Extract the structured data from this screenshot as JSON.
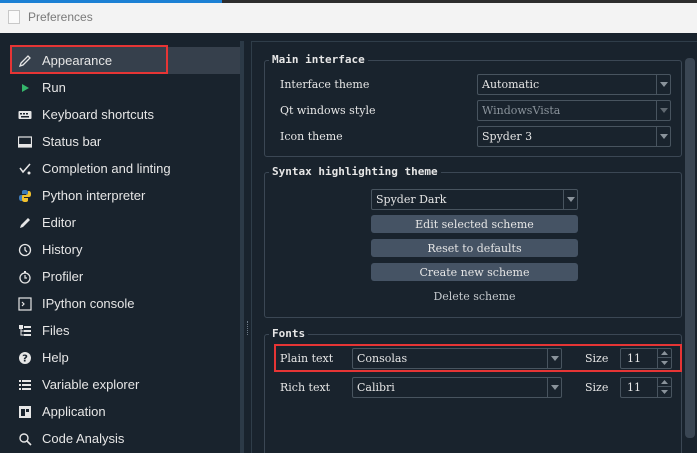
{
  "window": {
    "title": "Preferences"
  },
  "sidebar": {
    "items": [
      {
        "label": "Appearance",
        "icon": "pencil-icon",
        "selected": true
      },
      {
        "label": "Run",
        "icon": "play-icon"
      },
      {
        "label": "Keyboard shortcuts",
        "icon": "keyboard-icon"
      },
      {
        "label": "Status bar",
        "icon": "status-bar-icon"
      },
      {
        "label": "Completion and linting",
        "icon": "completion-icon"
      },
      {
        "label": "Python interpreter",
        "icon": "python-icon"
      },
      {
        "label": "Editor",
        "icon": "edit-icon"
      },
      {
        "label": "History",
        "icon": "history-icon"
      },
      {
        "label": "Profiler",
        "icon": "stopwatch-icon"
      },
      {
        "label": "IPython console",
        "icon": "console-icon"
      },
      {
        "label": "Files",
        "icon": "files-icon"
      },
      {
        "label": "Help",
        "icon": "help-icon"
      },
      {
        "label": "Variable explorer",
        "icon": "list-icon"
      },
      {
        "label": "Application",
        "icon": "application-icon"
      },
      {
        "label": "Code Analysis",
        "icon": "magnifier-icon"
      }
    ]
  },
  "main_interface": {
    "title": "Main interface",
    "interface_theme_label": "Interface theme",
    "interface_theme_value": "Automatic",
    "qt_style_label": "Qt windows style",
    "qt_style_value": "WindowsVista",
    "icon_theme_label": "Icon theme",
    "icon_theme_value": "Spyder 3"
  },
  "syntax": {
    "title": "Syntax highlighting theme",
    "scheme_value": "Spyder Dark",
    "edit_label": "Edit selected scheme",
    "reset_label": "Reset to defaults",
    "create_label": "Create new scheme",
    "delete_label": "Delete scheme"
  },
  "fonts": {
    "title": "Fonts",
    "plain_label": "Plain text",
    "plain_font": "Consolas",
    "plain_size_label": "Size",
    "plain_size": "11",
    "rich_label": "Rich text",
    "rich_font": "Calibri",
    "rich_size_label": "Size",
    "rich_size": "11"
  },
  "colors": {
    "highlight": "#e63535",
    "background": "#19232d",
    "button": "#455364"
  }
}
